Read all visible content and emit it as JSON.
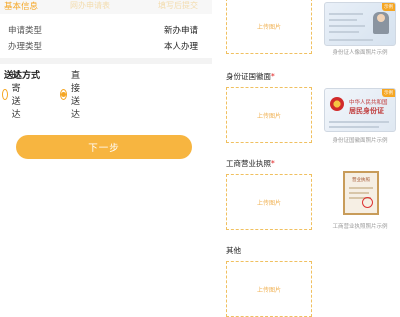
{
  "left": {
    "section_title": "基本信息",
    "header_faint_1": "网办申请表",
    "header_faint_2": "填写后提交",
    "rows": [
      {
        "key": "申请类型",
        "value": "新办申请"
      },
      {
        "key": "办理类型",
        "value": "本人办理"
      }
    ],
    "delivery": {
      "title": "送达方式",
      "options": [
        {
          "label": "邮寄送达",
          "selected": false
        },
        {
          "label": "直接送达",
          "selected": true
        }
      ]
    },
    "next_label": "下一步"
  },
  "right": {
    "upload_text": "上传图片",
    "fields": [
      {
        "label": "",
        "required": false,
        "caption": "身份证人像面照片示例"
      },
      {
        "label": "身份证国徽面",
        "required": true,
        "caption": "身份证国徽面照片示例"
      },
      {
        "label": "工商营业执照",
        "required": true,
        "caption": "工商营业执照照片示例"
      },
      {
        "label": "其他",
        "required": false,
        "caption": ""
      }
    ],
    "sample_tag": "示例",
    "card_back_title": "中华人民共和国",
    "card_back_subtitle": "居民身份证",
    "license_title": "营业执照"
  },
  "colors": {
    "accent": "#f5a623",
    "button": "#f7b540",
    "required": "#e02020"
  }
}
